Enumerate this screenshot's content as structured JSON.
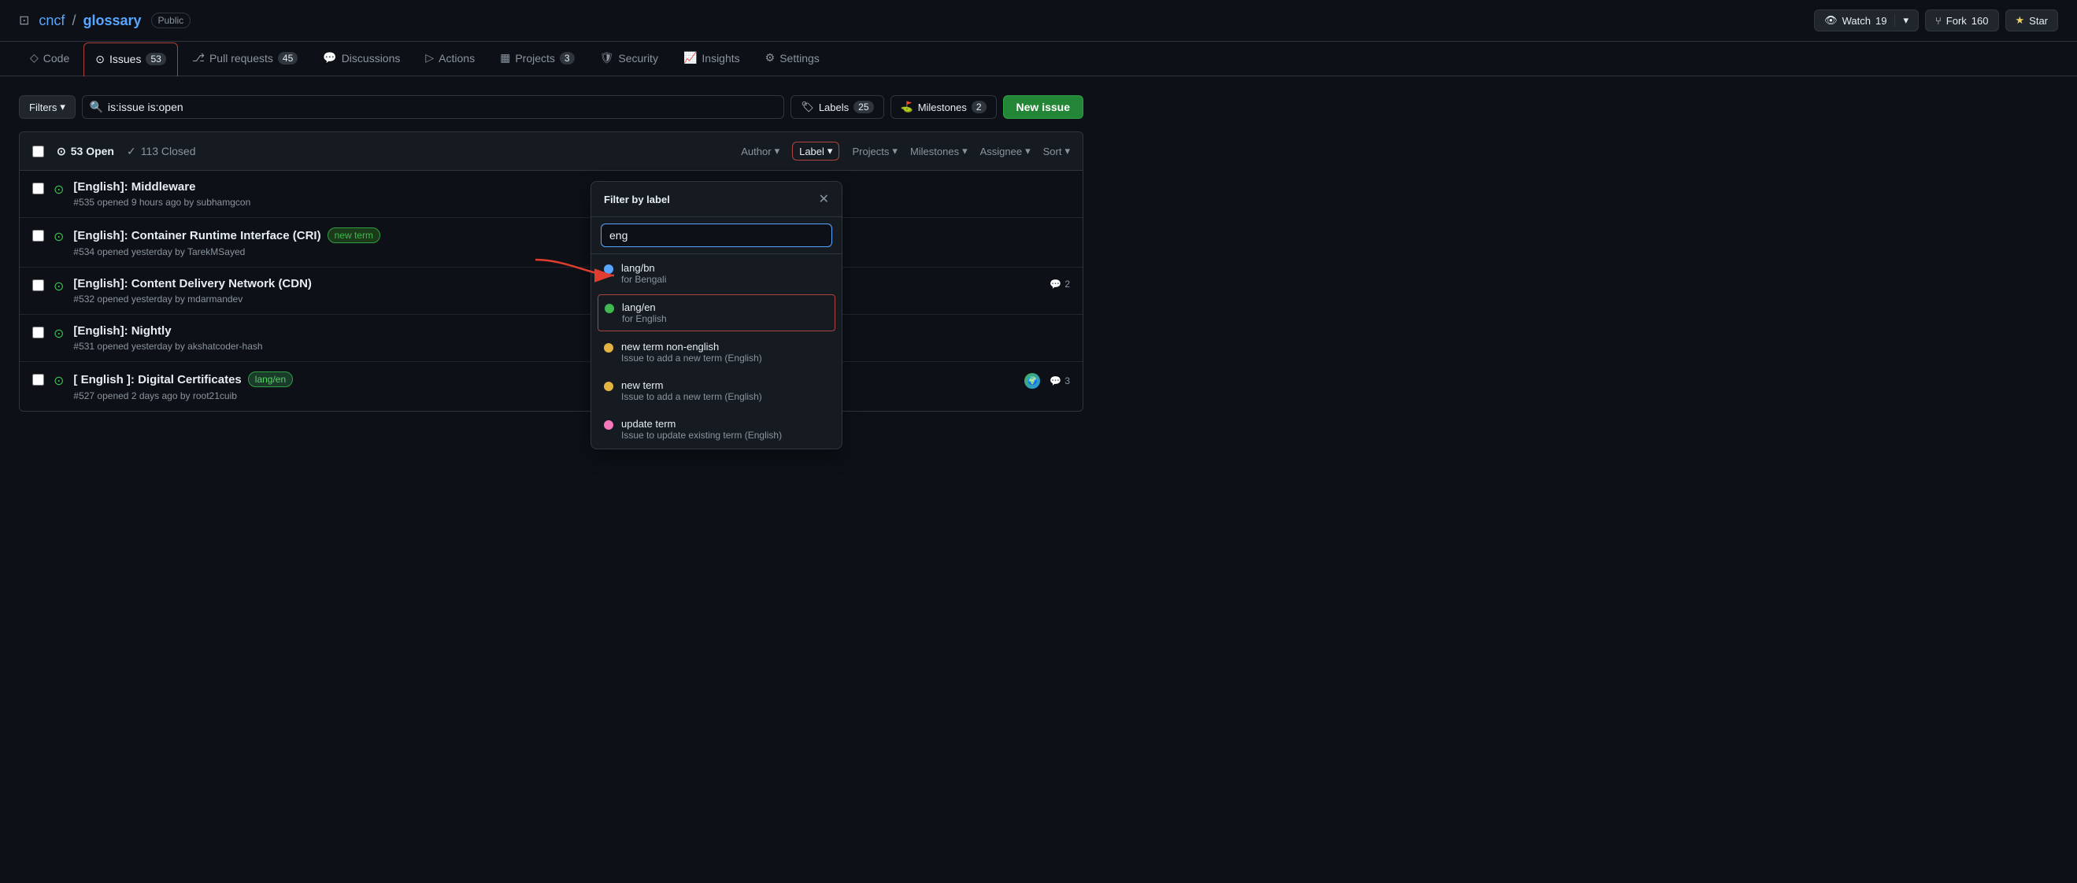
{
  "repo": {
    "org": "cncf",
    "name": "glossary",
    "badge": "Public"
  },
  "header_actions": {
    "watch_label": "Watch",
    "watch_count": "19",
    "fork_label": "Fork",
    "fork_count": "160",
    "star_label": "Star"
  },
  "nav_tabs": [
    {
      "id": "code",
      "icon": "◇",
      "label": "Code",
      "badge": null,
      "active": false
    },
    {
      "id": "issues",
      "icon": "⊙",
      "label": "Issues",
      "badge": "53",
      "active": true
    },
    {
      "id": "pull-requests",
      "icon": "⎇",
      "label": "Pull requests",
      "badge": "45",
      "active": false
    },
    {
      "id": "discussions",
      "icon": "💬",
      "label": "Discussions",
      "badge": null,
      "active": false
    },
    {
      "id": "actions",
      "icon": "▷",
      "label": "Actions",
      "badge": null,
      "active": false
    },
    {
      "id": "projects",
      "icon": "▦",
      "label": "Projects",
      "badge": "3",
      "active": false
    },
    {
      "id": "security",
      "icon": "🛡",
      "label": "Security",
      "badge": null,
      "active": false
    },
    {
      "id": "insights",
      "icon": "📈",
      "label": "Insights",
      "badge": null,
      "active": false
    },
    {
      "id": "settings",
      "icon": "⚙",
      "label": "Settings",
      "badge": null,
      "active": false
    }
  ],
  "filter_bar": {
    "filter_label": "Filters",
    "search_value": "is:issue is:open",
    "labels_label": "Labels",
    "labels_count": "25",
    "milestones_label": "Milestones",
    "milestones_count": "2",
    "new_issue_label": "New issue"
  },
  "issues_header": {
    "open_count": "53 Open",
    "closed_count": "113 Closed",
    "author_label": "Author",
    "label_label": "Label",
    "projects_label": "Projects",
    "milestones_label": "Milestones",
    "assignee_label": "Assignee",
    "sort_label": "Sort"
  },
  "issues": [
    {
      "id": "535",
      "title": "[English]: Middleware",
      "meta": "#535 opened 9 hours ago by subhamgcon",
      "labels": [],
      "comments": null,
      "avatar": null
    },
    {
      "id": "534",
      "title": "[English]: Container Runtime Interface (CRI)",
      "meta": "#534 opened yesterday by TarekMSayed",
      "labels": [
        {
          "text": "new term",
          "class": "label-new-term"
        }
      ],
      "comments": null,
      "avatar": null
    },
    {
      "id": "532",
      "title": "[English]: Content Delivery Network (CDN)",
      "meta": "#532 opened yesterday by mdarmandev",
      "labels": [],
      "comments": "2",
      "avatar": null
    },
    {
      "id": "531",
      "title": "[English]: Nightly",
      "meta": "#531 opened yesterday by akshatcoder-hash",
      "labels": [],
      "comments": null,
      "avatar": null
    },
    {
      "id": "527",
      "title": "[ English ]: Digital Certificates",
      "meta": "#527 opened 2 days ago by root21cuib",
      "labels": [
        {
          "text": "lang/en",
          "class": "label-lang-en"
        }
      ],
      "comments": "3",
      "avatar": "globe"
    }
  ],
  "dropdown": {
    "title": "Filter by label",
    "search_placeholder": "eng",
    "items": [
      {
        "id": "lang-bn",
        "name": "lang/bn",
        "desc": "for Bengali",
        "dot_class": "dot-blue",
        "selected": false
      },
      {
        "id": "lang-en",
        "name": "lang/en",
        "desc": "for English",
        "dot_class": "dot-green",
        "selected": true
      },
      {
        "id": "new-term-non-english",
        "name": "new term non-english",
        "desc": "Issue to add a new term (English)",
        "dot_class": "dot-yellow",
        "selected": false
      },
      {
        "id": "new-term",
        "name": "new term",
        "desc": "Issue to add a new term (English)",
        "dot_class": "dot-yellow",
        "selected": false
      },
      {
        "id": "update-term",
        "name": "update term",
        "desc": "Issue to update existing term (English)",
        "dot_class": "dot-pink",
        "selected": false
      }
    ]
  }
}
